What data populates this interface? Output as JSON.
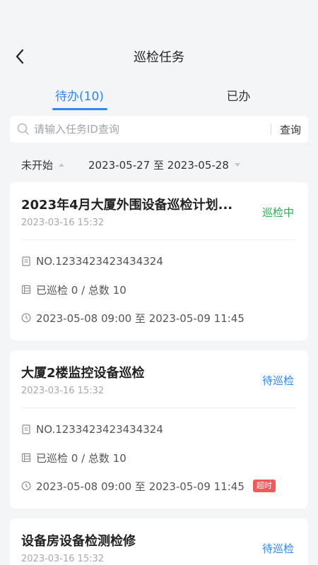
{
  "nav": {
    "title": "巡检任务"
  },
  "tabs": [
    {
      "label": "待办(10)"
    },
    {
      "label": "已办"
    }
  ],
  "search": {
    "placeholder": "请输入任务ID查询",
    "button": "查询"
  },
  "filters": {
    "status": "未开始",
    "date_range": "2023-05-27 至 2023-05-28"
  },
  "colors": {
    "accent": "#2f86f6",
    "green": "#22b14c",
    "overdue": "#f3585a"
  },
  "cards": [
    {
      "title": "2023年4月大厦外围设备巡检计划...",
      "created": "2023-03-16 15:32",
      "status": "巡检中",
      "number": "NO.1233423423434324",
      "progress": "已巡检 0 / 总数 10",
      "period": "2023-05-08 09:00 至 2023-05-09 11:45",
      "badge": ""
    },
    {
      "title": "大厦2楼监控设备巡检",
      "created": "2023-03-16 15:32",
      "status": "待巡检",
      "number": "NO.1233423423434324",
      "progress": "已巡检 0 / 总数 10",
      "period": "2023-05-08 09:00 至 2023-05-09 11:45",
      "badge": "超时"
    },
    {
      "title": "设备房设备检测检修",
      "created": "2023-03-16 15:32",
      "status": "待巡检"
    }
  ]
}
